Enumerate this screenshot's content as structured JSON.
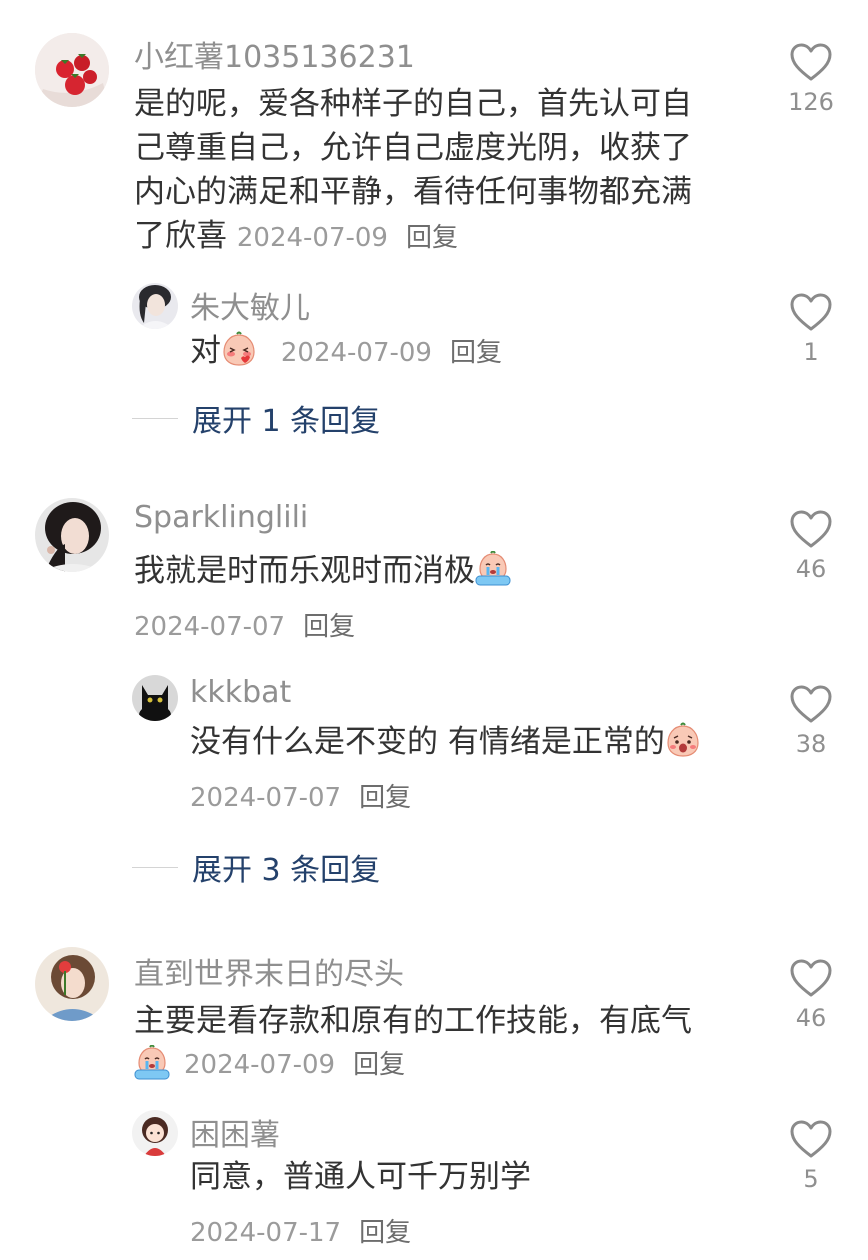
{
  "comments": [
    {
      "username": "小红薯1035136231",
      "text": "是的呢，爱各种样子的自己，首先认可自己尊重自己，允许自己虚度光阴，收获了内心的满足和平静，看待任何事物都充满了欣喜",
      "lines": [
        "是的呢，爱各种样子的自己，首先认可自",
        "己尊重自己，允许自己虚度光阴，收获了",
        "内心的满足和平静，看待任何事物都充满",
        "了欣喜"
      ],
      "date": "2024-07-09",
      "reply_label": "回复",
      "likes": "126",
      "avatar": "strawberries",
      "replies": [
        {
          "username": "朱大敏儿",
          "text": "对",
          "emoji": "blush-kiss",
          "date": "2024-07-09",
          "reply_label": "回复",
          "likes": "1",
          "avatar": "girl-portrait"
        }
      ],
      "expand_label": "展开 1 条回复"
    },
    {
      "username": "Sparklinglili",
      "text": "我就是时而乐观时而消极",
      "emoji": "crying-face",
      "date": "2024-07-07",
      "reply_label": "回复",
      "likes": "46",
      "avatar": "woman-portrait",
      "replies": [
        {
          "username": "kkkbat",
          "text": "没有什么是不变的 有情绪是正常的",
          "emoji": "shocked-face",
          "date": "2024-07-07",
          "reply_label": "回复",
          "likes": "38",
          "avatar": "black-cat"
        }
      ],
      "expand_label": "展开 3 条回复"
    },
    {
      "username": "直到世界末日的尽头",
      "text": "主要是看存款和原有的工作技能，有底气",
      "emoji": "crying-face",
      "date": "2024-07-09",
      "reply_label": "回复",
      "likes": "46",
      "avatar": "girl-with-flower",
      "replies": [
        {
          "username": "困困薯",
          "text": "同意，普通人可千万别学",
          "date": "2024-07-17",
          "reply_label": "回复",
          "likes": "5",
          "avatar": "cartoon-girl"
        }
      ]
    }
  ],
  "colors": {
    "text": "#333333",
    "username": "#8f8f8f",
    "meta": "#9b9b9b",
    "expand_link": "#24416b",
    "heart_stroke": "#8a8a8a"
  }
}
